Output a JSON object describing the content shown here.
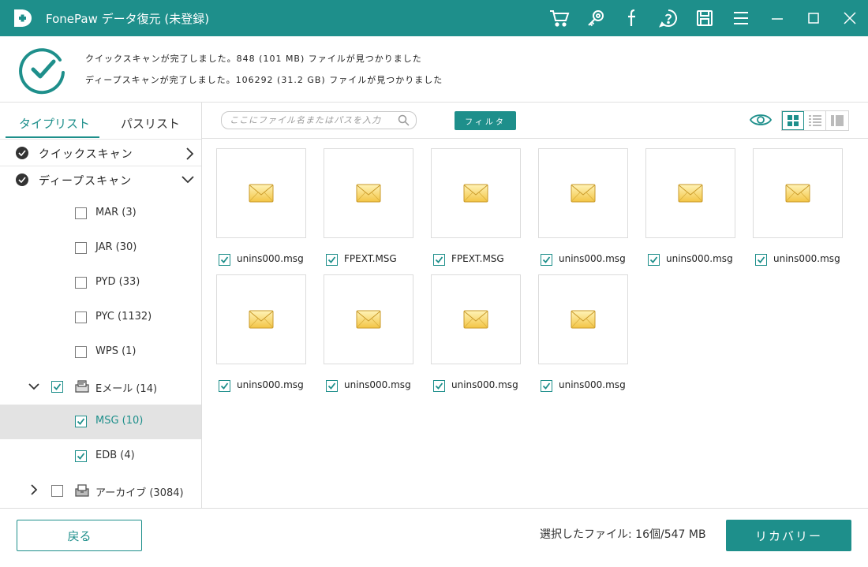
{
  "app": {
    "title": "FonePaw データ復元 (未登録)",
    "accent_color": "#1e8f8b",
    "title_icons": [
      "cart-icon",
      "key-icon",
      "facebook-icon",
      "help-icon",
      "save-icon",
      "menu-icon",
      "minimize-icon",
      "maximize-icon",
      "close-icon"
    ]
  },
  "summary": {
    "quick_scan": "クイックスキャンが完了しました。848 (101 MB) ファイルが見つかりました",
    "deep_scan": "ディープスキャンが完了しました。106292 (31.2 GB) ファイルが見つかりました"
  },
  "sidebar": {
    "tabs": [
      {
        "label": "タイプリスト",
        "active": true
      },
      {
        "label": "パスリスト",
        "active": false
      }
    ],
    "scans": [
      {
        "label": "クイックスキャン",
        "expanded": false
      },
      {
        "label": "ディープスキャン",
        "expanded": true
      }
    ],
    "tree": [
      {
        "label": "MAR (3)",
        "checked": false
      },
      {
        "label": "JAR (30)",
        "checked": false
      },
      {
        "label": "PYD (33)",
        "checked": false
      },
      {
        "label": "PYC (1132)",
        "checked": false
      },
      {
        "label": "WPS (1)",
        "checked": false
      },
      {
        "label": "Eメール (14)",
        "checked": true,
        "expanded": true,
        "icon": "email-folder-icon"
      },
      {
        "label": "MSG (10)",
        "checked": true,
        "selected": true
      },
      {
        "label": "EDB (4)",
        "checked": true
      },
      {
        "label": "アーカイブ (3084)",
        "checked": false,
        "expanded": false,
        "icon": "archive-folder-icon"
      }
    ]
  },
  "toolbar": {
    "search_placeholder": "ここにファイル名またはパスを入力",
    "filter_label": "フィルタ",
    "view_mode": "grid"
  },
  "files": [
    {
      "name": "unins000.msg",
      "checked": true
    },
    {
      "name": "FPEXT.MSG",
      "checked": true
    },
    {
      "name": "FPEXT.MSG",
      "checked": true
    },
    {
      "name": "unins000.msg",
      "checked": true
    },
    {
      "name": "unins000.msg",
      "checked": true
    },
    {
      "name": "unins000.msg",
      "checked": true
    },
    {
      "name": "unins000.msg",
      "checked": true
    },
    {
      "name": "unins000.msg",
      "checked": true
    },
    {
      "name": "unins000.msg",
      "checked": true
    },
    {
      "name": "unins000.msg",
      "checked": true
    }
  ],
  "footer": {
    "back_label": "戻る",
    "selected_text": "選択したファイル: 16個/547 MB",
    "recover_label": "リカバリー"
  }
}
